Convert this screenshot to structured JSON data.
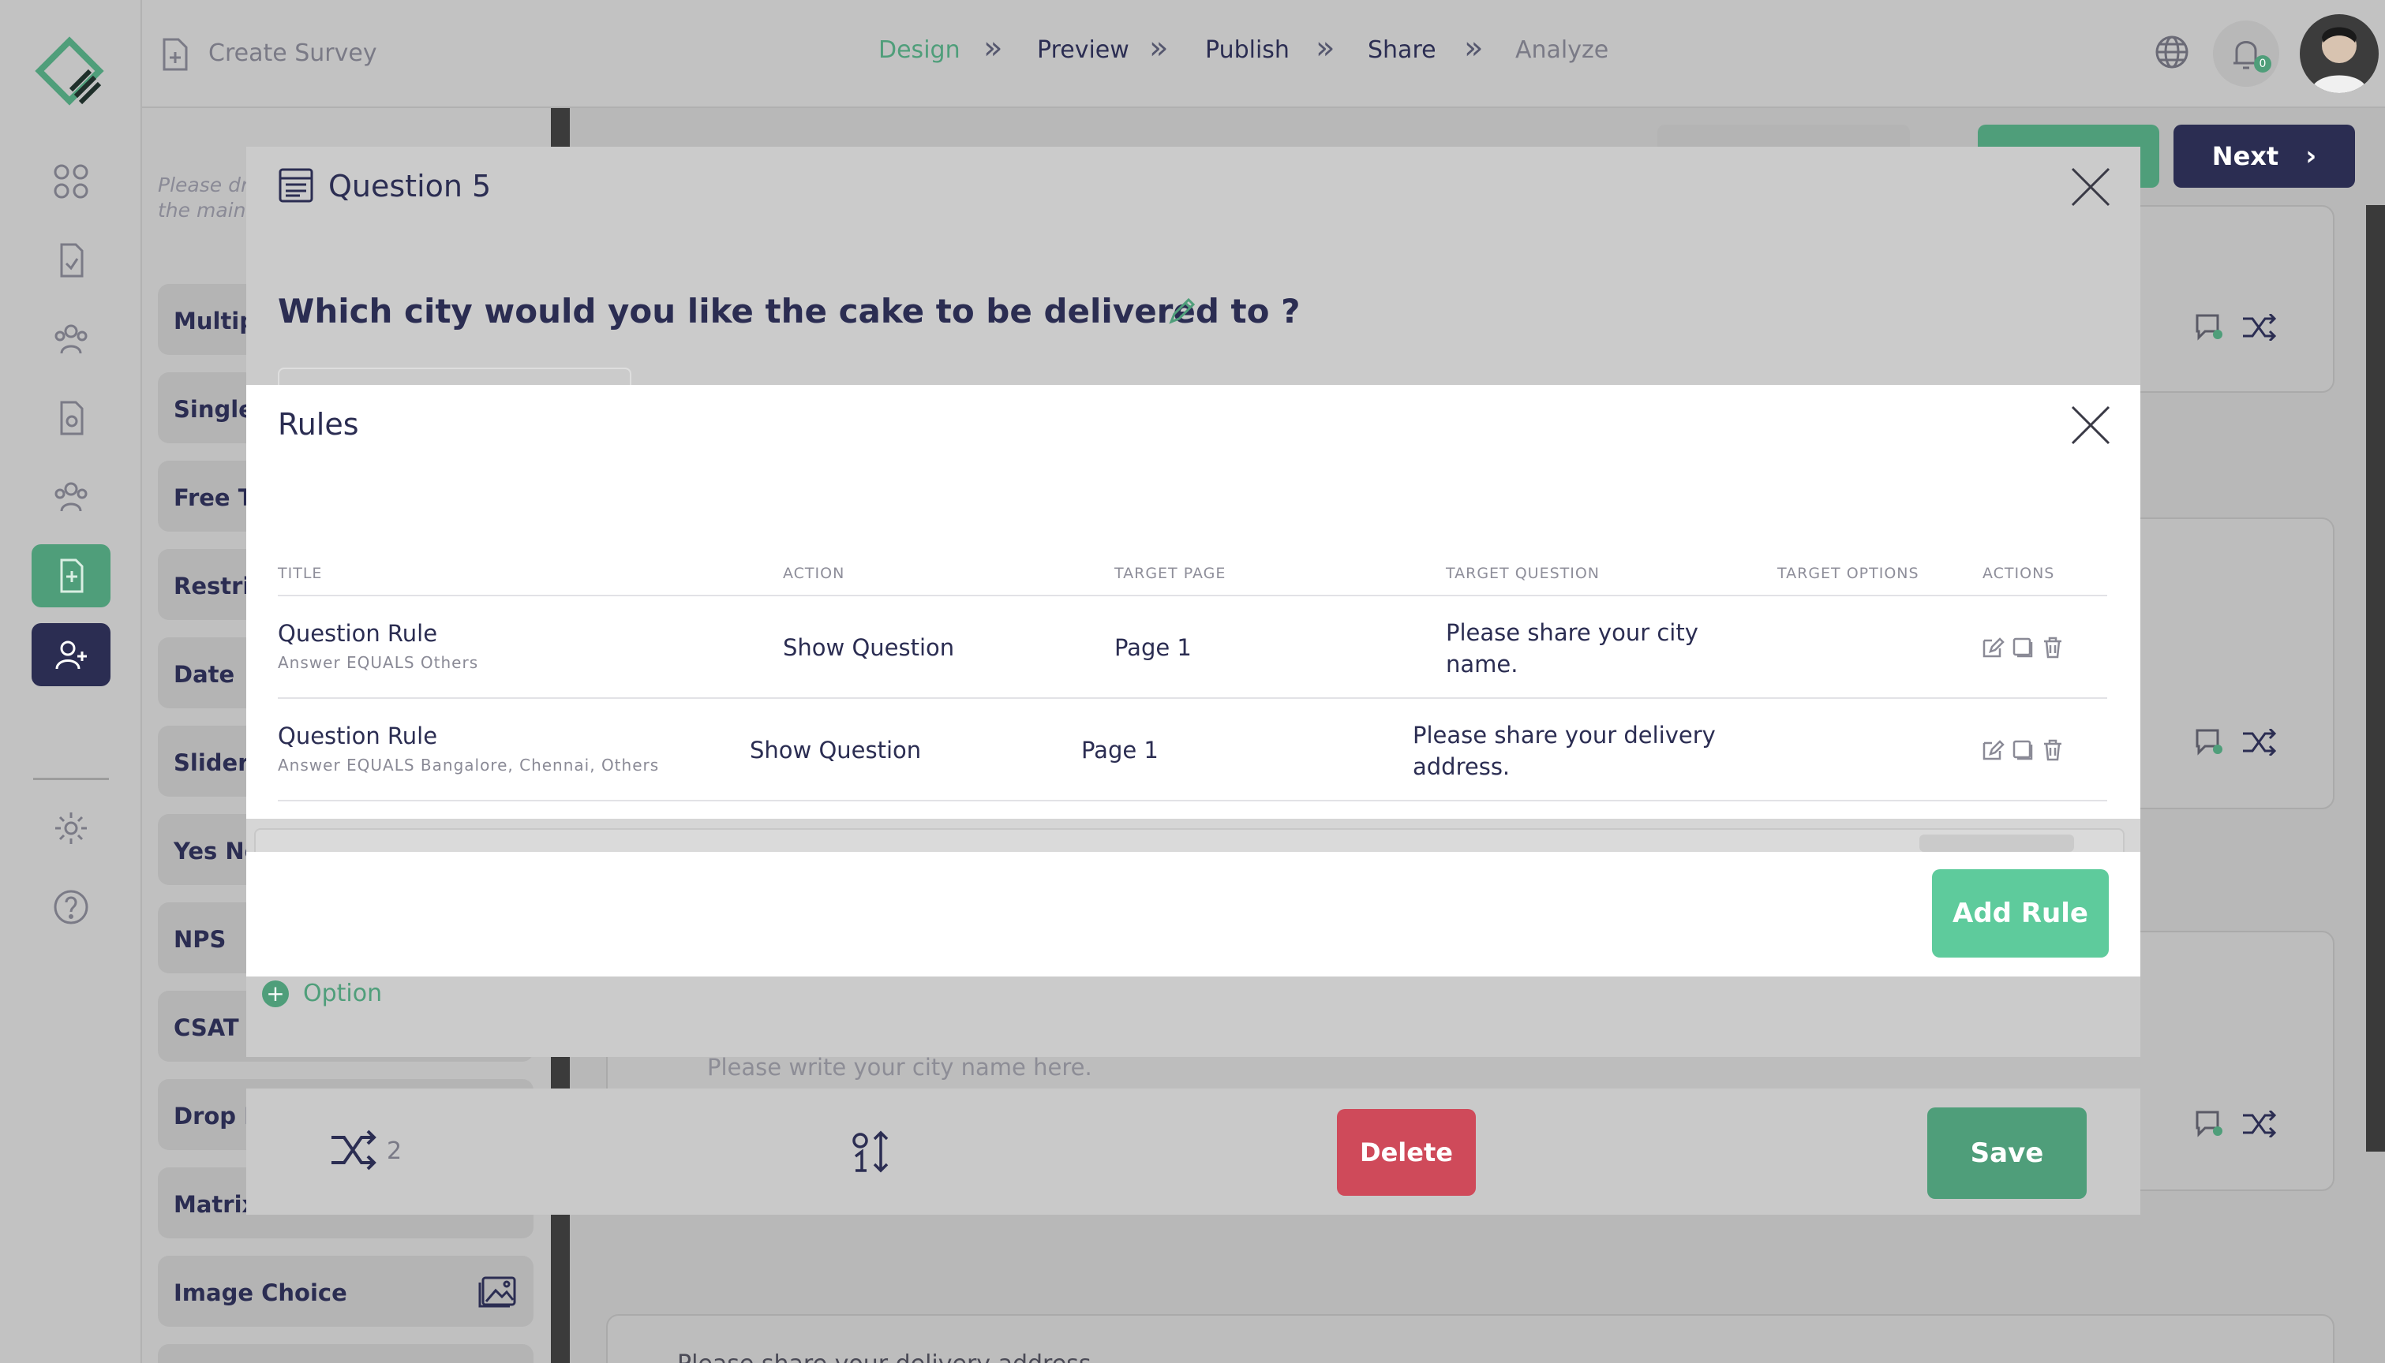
{
  "topbar": {
    "create_survey": "Create Survey",
    "steps": [
      "Design",
      "Preview",
      "Publish",
      "Share",
      "Analyze"
    ],
    "next_label": "Next",
    "notification_count": "0"
  },
  "palette": {
    "hint_line1": "Please dr",
    "hint_line2": "the main",
    "items": [
      "Multipl",
      "Single",
      "Free Te",
      "Restric",
      "Date",
      "Slider",
      "Yes No",
      "NPS",
      "CSAT R",
      "Drop D",
      "Matrix",
      "Image Choice"
    ]
  },
  "canvas": {
    "city_placeholder": "Please write your city name here.",
    "delivery_text": "Please share your delivery address."
  },
  "question_modal": {
    "title": "Question 5",
    "question_text": "Which city would you like the cake to be delivered to ?",
    "add_option": "Option",
    "rules_count": "2",
    "delete_label": "Delete",
    "save_label": "Save"
  },
  "rules_modal": {
    "title": "Rules",
    "headers": [
      "TITLE",
      "ACTION",
      "TARGET PAGE",
      "TARGET QUESTION",
      "TARGET OPTIONS",
      "ACTIONS"
    ],
    "rows": [
      {
        "title": "Question Rule",
        "condition": "Answer EQUALS Others",
        "action": "Show Question",
        "page": "Page 1",
        "question_line1": "Please share your city",
        "question_line2": "name."
      },
      {
        "title": "Question Rule",
        "condition": "Answer EQUALS Bangalore, Chennai, Others",
        "action": "Show Question",
        "page": "Page 1",
        "question_line1": "Please share your delivery",
        "question_line2": "address."
      }
    ],
    "add_rule_label": "Add Rule"
  },
  "colors": {
    "accent_green": "#5ecb9c",
    "save_green": "#4fa07f",
    "danger": "#cf4a5a",
    "navy": "#2b2d52"
  }
}
